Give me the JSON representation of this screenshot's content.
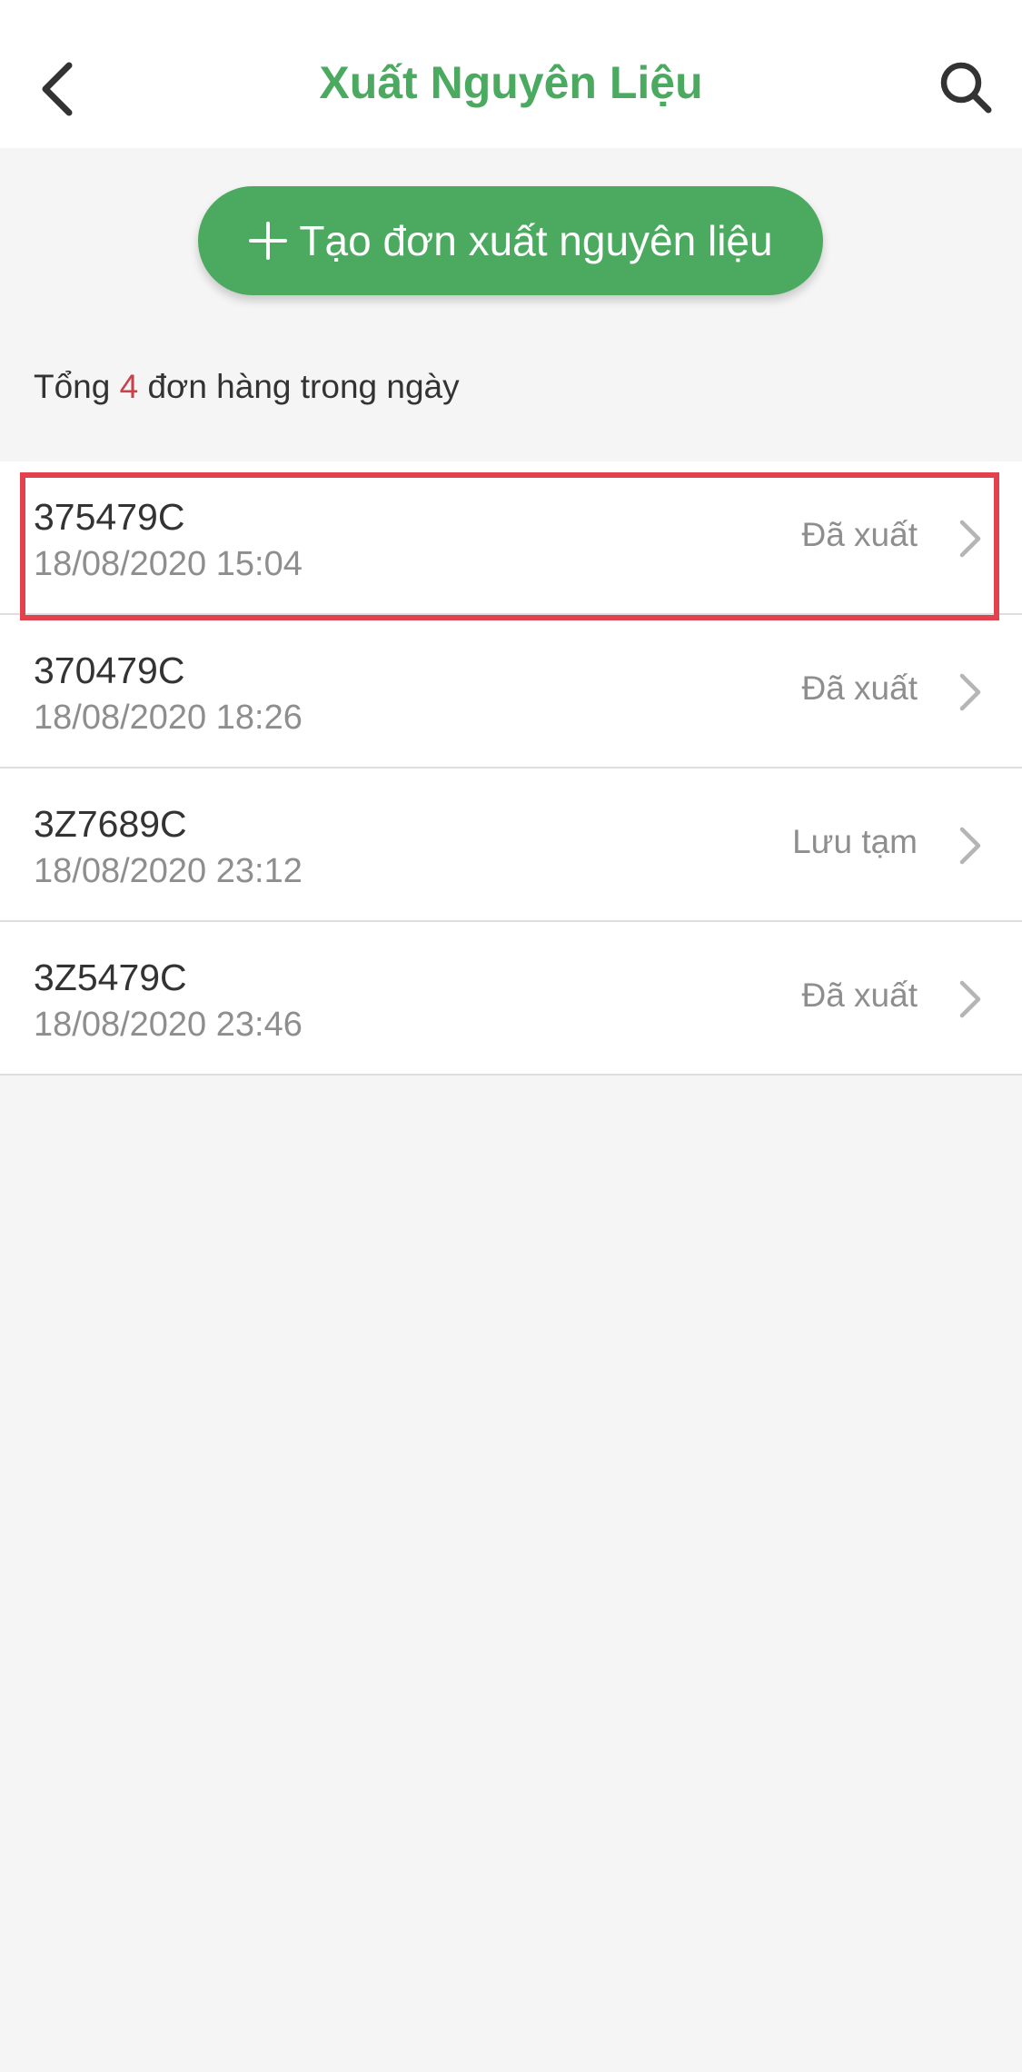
{
  "header": {
    "title": "Xuất Nguyên Liệu",
    "back_icon": "chevron-left-icon",
    "search_icon": "search-icon"
  },
  "create_button": {
    "label": "Tạo đơn xuất nguyên liệu",
    "icon": "plus-icon"
  },
  "summary": {
    "prefix": "Tổng",
    "count": "4",
    "suffix": "đơn hàng trong ngày"
  },
  "orders": [
    {
      "code": "375479C",
      "date": "18/08/2020 15:04",
      "status": "Đã xuất"
    },
    {
      "code": "370479C",
      "date": "18/08/2020 18:26",
      "status": "Đã xuất"
    },
    {
      "code": "3Z7689C",
      "date": "18/08/2020 23:12",
      "status": "Lưu tạm"
    },
    {
      "code": "3Z5479C",
      "date": "18/08/2020 23:46",
      "status": "Đã xuất"
    }
  ],
  "colors": {
    "brand_green": "#4caa60",
    "count_red": "#c9414a",
    "highlight_red": "#e2424e"
  }
}
